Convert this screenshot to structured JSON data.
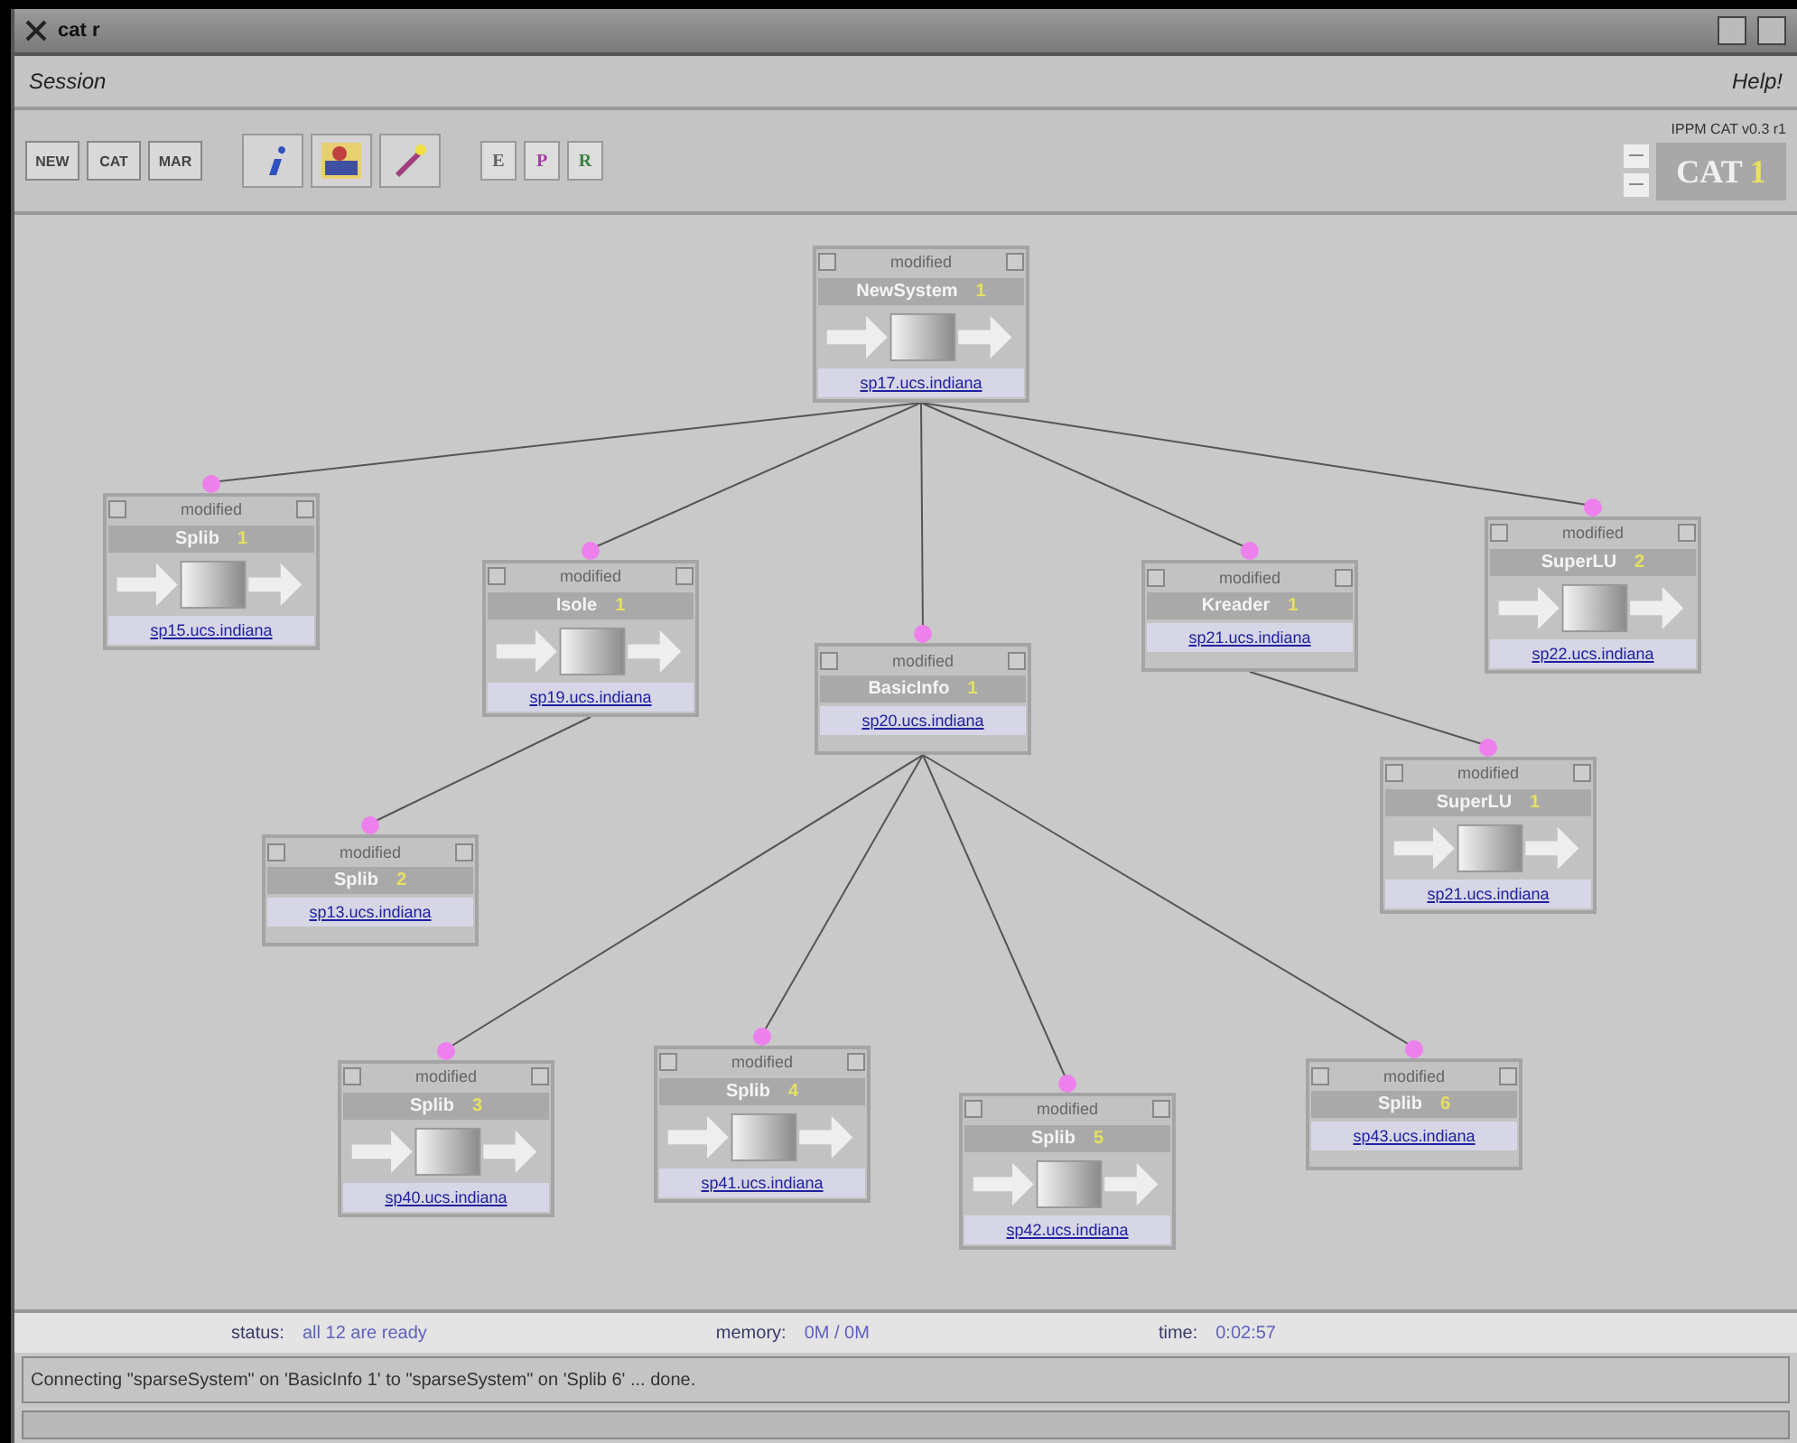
{
  "window": {
    "title": "cat r"
  },
  "menu": {
    "left": "Session",
    "right": "Help!"
  },
  "toolbar": {
    "text_buttons": [
      {
        "label": "NEW"
      },
      {
        "label": "CAT"
      },
      {
        "label": "MAR"
      }
    ],
    "letter_buttons": [
      {
        "label": "E",
        "color": "#606060"
      },
      {
        "label": "P",
        "color": "#a040a0"
      },
      {
        "label": "R",
        "color": "#3c8040"
      }
    ],
    "version": "IPPM CAT v0.3 r1",
    "logo": {
      "text": "CAT",
      "mark": "1"
    }
  },
  "graph": {
    "root": {
      "status": "modified",
      "name": "NewSystem",
      "number": "1",
      "host": "sp17.ucs.indiana",
      "kind": "full",
      "children": [
        {
          "status": "modified",
          "name": "Splib",
          "number": "1",
          "host": "sp15.ucs.indiana",
          "kind": "full"
        },
        {
          "status": "modified",
          "name": "Isole",
          "number": "1",
          "host": "sp19.ucs.indiana",
          "kind": "full",
          "children": [
            {
              "status": "modified",
              "name": "Splib",
              "number": "2",
              "host": "sp13.ucs.indiana",
              "kind": "compact"
            }
          ]
        },
        {
          "status": "modified",
          "name": "BasicInfo",
          "number": "1",
          "host": "sp20.ucs.indiana",
          "kind": "compact",
          "children": [
            {
              "status": "modified",
              "name": "Splib",
              "number": "3",
              "host": "sp40.ucs.indiana",
              "kind": "full"
            },
            {
              "status": "modified",
              "name": "Splib",
              "number": "4",
              "host": "sp41.ucs.indiana",
              "kind": "full"
            },
            {
              "status": "modified",
              "name": "Splib",
              "number": "5",
              "host": "sp42.ucs.indiana",
              "kind": "full"
            },
            {
              "status": "modified",
              "name": "Splib",
              "number": "6",
              "host": "sp43.ucs.indiana",
              "kind": "compact"
            }
          ]
        },
        {
          "status": "modified",
          "name": "Kreader",
          "number": "1",
          "host": "sp21.ucs.indiana",
          "kind": "compact",
          "children": [
            {
              "status": "modified",
              "name": "SuperLU",
              "number": "1",
              "host": "sp21.ucs.indiana",
              "kind": "full"
            }
          ]
        },
        {
          "status": "modified",
          "name": "SuperLU",
          "number": "2",
          "host": "sp22.ucs.indiana",
          "kind": "full"
        }
      ]
    }
  },
  "status_bar": {
    "status_label": "status:",
    "status_value": "all 12 are ready",
    "memory_label": "memory:",
    "memory_value": "0M / 0M",
    "time_label": "time:",
    "time_value": "0:02:57"
  },
  "message": "Connecting \"sparseSystem\" on 'BasicInfo 1' to \"sparseSystem\" on 'Splib 6' ... done."
}
